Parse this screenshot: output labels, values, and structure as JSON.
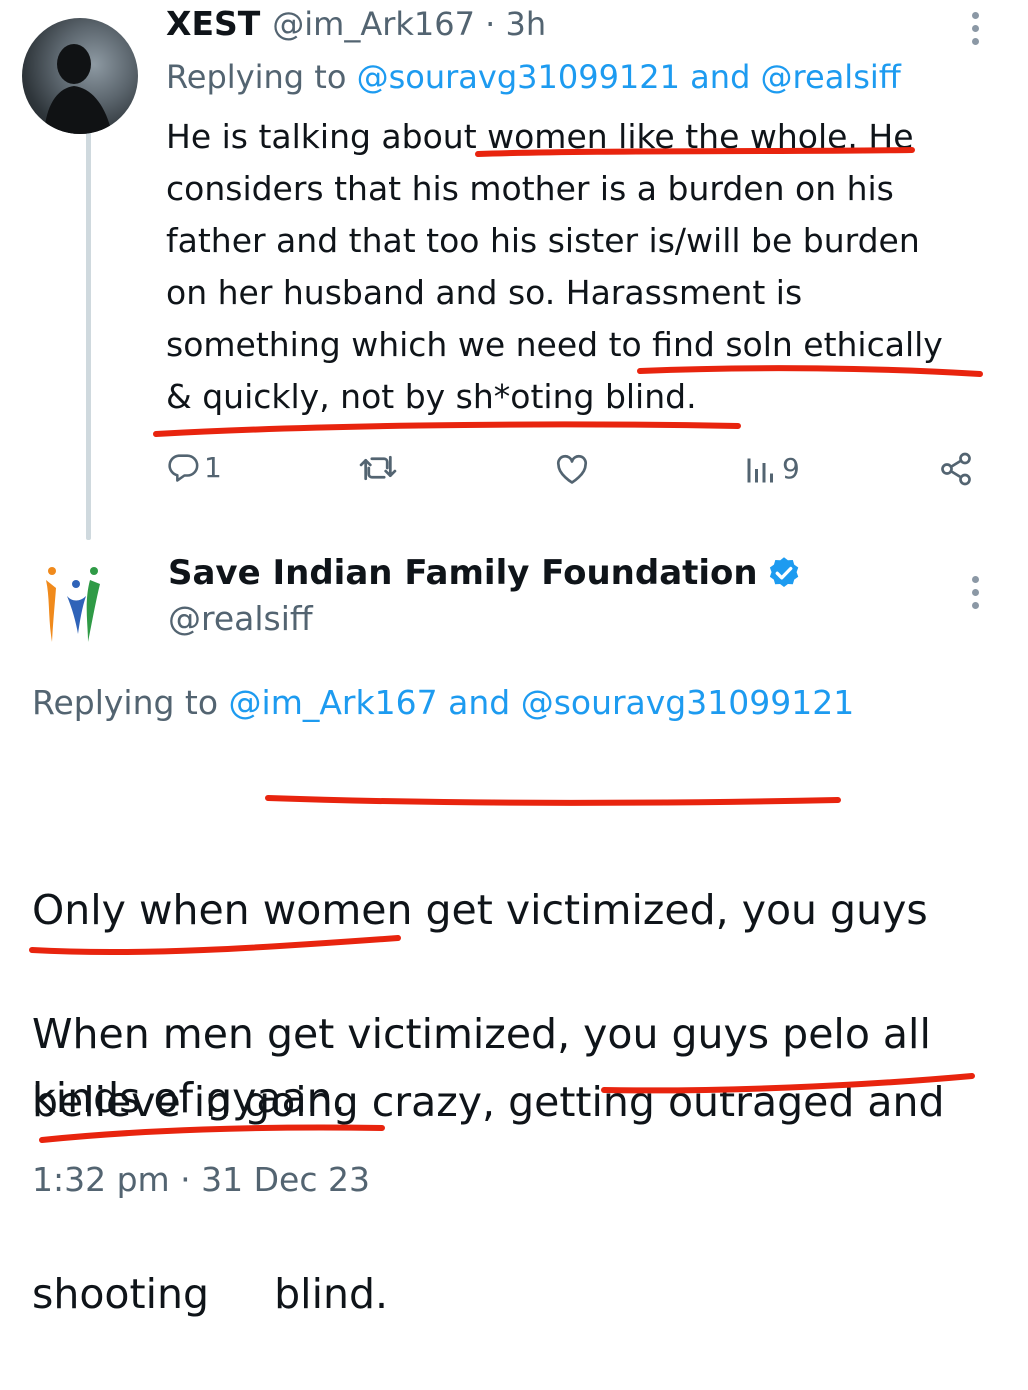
{
  "first_tweet": {
    "display_name": "XEST",
    "handle_time": "@im_Ark167 · 3h",
    "replying_prefix": "Replying to ",
    "replying_user1": "@souravg31099121",
    "replying_and": " and ",
    "replying_user2": "@realsiff",
    "lines": [
      "He is talking about women like the whole. He",
      "considers that his mother is a burden on his",
      "father and that too his sister is/will be burden",
      "on her husband and so. Harassment is",
      "something which we need to find soln ethically",
      "& quickly, not by sh*oting blind."
    ],
    "actions": {
      "reply_count": "1",
      "views_count": "9"
    }
  },
  "second_tweet": {
    "display_name": "Save Indian Family Foundation",
    "handle": "@realsiff",
    "replying_prefix": "Replying to ",
    "replying_user1": "@im_Ark167",
    "replying_and": " and ",
    "replying_user2": "@souravg31099121",
    "para1_lines": [
      "Only when women get victimized, you guys",
      "believe in going crazy, getting outraged and",
      "shooting     blind."
    ],
    "para2_lines": [
      "When men get victimized, you guys pelo all",
      "kinds of gyaan."
    ],
    "timestamp": "1:32 pm · 31 Dec 23"
  },
  "colors": {
    "accent": "#1d9bf0",
    "verified": "#1d9bf0",
    "annotation_red": "#e8240e"
  }
}
